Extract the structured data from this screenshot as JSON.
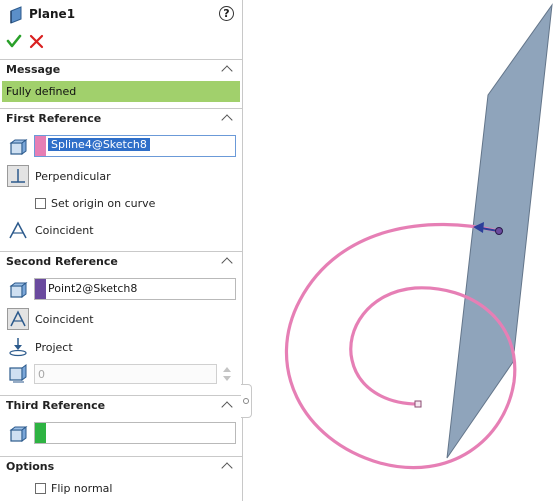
{
  "feature": {
    "title": "Plane1",
    "help_label": "?"
  },
  "message": {
    "header": "Message",
    "text": "Fully defined"
  },
  "first_reference": {
    "header": "First Reference",
    "entity": "Spline4@Sketch8",
    "swatch_color": "#e67fb5",
    "constraint_label": "Perpendicular",
    "set_origin_label": "Set origin on curve",
    "coincident_label": "Coincident"
  },
  "second_reference": {
    "header": "Second Reference",
    "entity": "Point2@Sketch8",
    "swatch_color": "#6a4a9e",
    "coincident_label": "Coincident",
    "project_label": "Project",
    "distance_value": "0"
  },
  "third_reference": {
    "header": "Third Reference",
    "entity": "",
    "swatch_color": "#2eb342"
  },
  "options": {
    "header": "Options",
    "flip_normal_label": "Flip normal"
  },
  "colors": {
    "message_bg": "#a1d06c",
    "selection": "#2f6fc9",
    "plane_fill": "#8aa0b8",
    "spline": "#e67fb5"
  }
}
